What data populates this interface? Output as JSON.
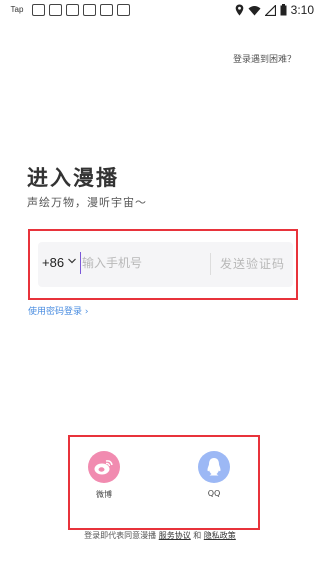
{
  "status_bar": {
    "app_label": "Tap",
    "time": "3:10",
    "colors": {
      "icon": "#222222"
    }
  },
  "header": {
    "help_link": "登录遇到困难？"
  },
  "main": {
    "title": "进入漫播",
    "subtitle": "声绘万物，漫听宇宙～"
  },
  "phone_form": {
    "country_code": "+86",
    "phone_placeholder": "输入手机号",
    "phone_value": "",
    "send_code_label": "发送验证码"
  },
  "password_login_label": "使用密码登录 ›",
  "social_login": {
    "items": [
      {
        "label": "微博",
        "icon": "weibo-icon",
        "color": "#f18bb0"
      },
      {
        "label": "QQ",
        "icon": "qq-icon",
        "color": "#9cb8f5"
      }
    ]
  },
  "agreement": {
    "prefix": "登录即代表同意漫播 ",
    "service_link": "服务协议",
    "middle": " 和 ",
    "privacy_link": "隐私政策"
  },
  "colors": {
    "highlight_border": "#e8333b",
    "link_blue": "#4a8de0",
    "cursor": "#7b57d8"
  }
}
